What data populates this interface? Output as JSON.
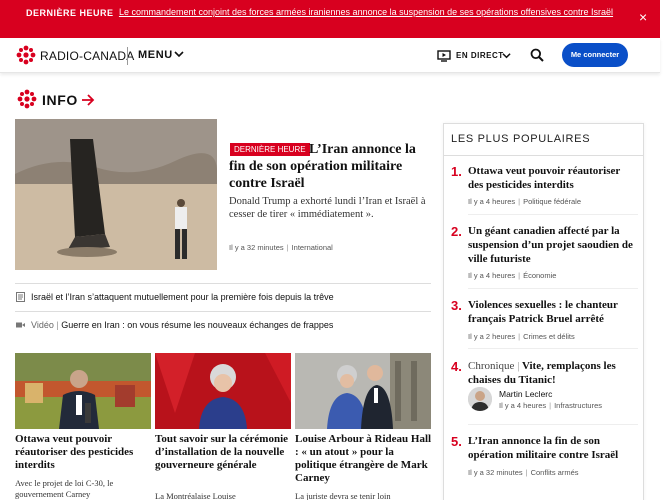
{
  "breaking": {
    "tag": "DERNIÈRE HEURE",
    "message": "Le commandement conjoint des forces armées iraniennes annonce la suspension de ses opérations offensives contre Israël",
    "close_icon": "×"
  },
  "header": {
    "brand": "RADIO-CANADA",
    "menu": "MENU",
    "live": "EN DIRECT",
    "connect": "Me connecter"
  },
  "section": {
    "title": "INFO"
  },
  "lead": {
    "badge": "DERNIÈRE HEURE",
    "title": "L’Iran annonce la fin de son opération militaire contre Israël",
    "summary": "Donald Trump a exhorté lundi l’Iran et Israël à cesser de tirer « immédiatement ».",
    "time": "Il y a 32 minutes",
    "category": "International"
  },
  "related": [
    {
      "prefix": "",
      "text": "Israël et l’Iran s’attaquent mutuellement pour la première fois depuis la trêve",
      "icon": "article-icon"
    },
    {
      "prefix": "Vidéo",
      "text": "Guerre en Iran : on vous résume les nouveaux échanges de frappes",
      "icon": "video-icon"
    }
  ],
  "cards": [
    {
      "title": "Ottawa veut pouvoir réautoriser des pesticides interdits",
      "summary": "Avec le projet de loi C-30, le gouvernement Carney"
    },
    {
      "title": "Tout savoir sur la cérémonie d’installation de la nouvelle gouverneure générale",
      "summary": "La Montréalaise Louise"
    },
    {
      "title": "Louise Arbour à Rideau Hall : « un atout » pour la politique étrangère de Mark Carney",
      "summary": "La juriste devra se tenir loin"
    }
  ],
  "popular": {
    "heading": "LES PLUS POPULAIRES",
    "items": [
      {
        "num": "1.",
        "title": "Ottawa veut pouvoir réautoriser des pesticides interdits",
        "time": "Il y a 4 heures",
        "category": "Politique fédérale"
      },
      {
        "num": "2.",
        "title": "Un géant canadien affecté par la suspension d’un projet saoudien de ville futuriste",
        "time": "Il y a 4 heures",
        "category": "Économie"
      },
      {
        "num": "3.",
        "title": "Violences sexuelles : le chanteur français Patrick Bruel arrêté",
        "time": "Il y a 2 heures",
        "category": "Crimes et délits"
      },
      {
        "num": "4.",
        "prefix": "Chronique",
        "title": "Vite, remplaçons les chaises du Titanic!",
        "author": "Martin Leclerc",
        "time": "Il y a 4 heures",
        "category": "Infrastructures"
      },
      {
        "num": "5.",
        "title": "L’Iran annonce la fin de son opération militaire contre Israël",
        "time": "Il y a 32 minutes",
        "category": "Conflits armés"
      }
    ]
  },
  "colors": {
    "brand_red": "#d8001f",
    "button_blue": "#0a4fc8"
  }
}
